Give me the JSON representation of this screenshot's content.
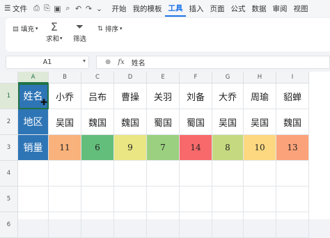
{
  "menubar": {
    "file_label": "文件",
    "quick_icons": [
      "save-icon",
      "print-icon",
      "print-preview-icon",
      "find-icon",
      "undo-icon",
      "redo-icon",
      "dropdown-icon"
    ],
    "tabs": [
      "开始",
      "我的模板",
      "工具",
      "插入",
      "页面",
      "公式",
      "数据",
      "审阅",
      "视图"
    ],
    "active_tab": "工具"
  },
  "ribbon": {
    "fill_label": "填充",
    "sum_label": "求和",
    "filter_label": "筛选",
    "sort_label": "排序"
  },
  "formula_bar": {
    "cell_ref": "A1",
    "fx_label": "fx",
    "content": "姓名"
  },
  "sheet": {
    "columns": [
      "A",
      "B",
      "C",
      "D",
      "E",
      "F",
      "G",
      "H",
      "I"
    ],
    "rows": [
      "1",
      "2",
      "3",
      "4",
      "5",
      "6"
    ],
    "row1": [
      "姓名",
      "小乔",
      "吕布",
      "曹操",
      "关羽",
      "刘备",
      "大乔",
      "周瑜",
      "貂蝉"
    ],
    "row2": [
      "地区",
      "吴国",
      "魏国",
      "魏国",
      "蜀国",
      "蜀国",
      "吴国",
      "吴国",
      "魏国"
    ],
    "row3": [
      "销量",
      "11",
      "6",
      "9",
      "7",
      "14",
      "8",
      "10",
      "13"
    ],
    "sales_colors": [
      "#f9b27b",
      "#63be7b",
      "#e9e683",
      "#9ad07f",
      "#f8696b",
      "#c5da80",
      "#fed880",
      "#fba27a"
    ],
    "header_color": "#2e75b6",
    "selected_cell": "A1"
  }
}
